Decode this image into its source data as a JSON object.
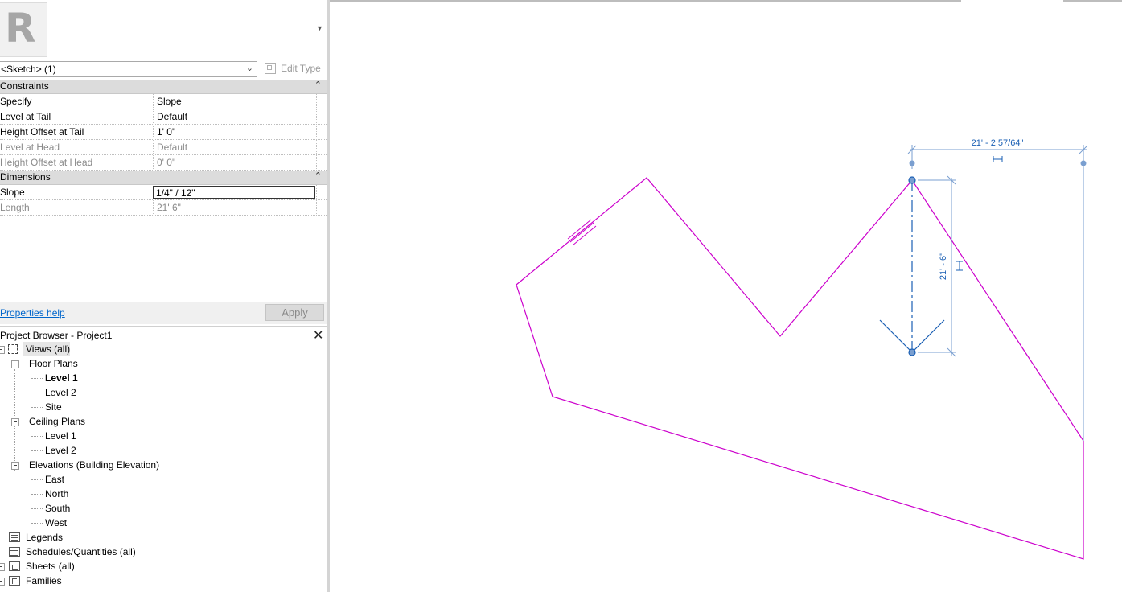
{
  "type_selector": {
    "logo_letter": "R",
    "instance_label": "<Sketch> (1)",
    "edit_type_label": "Edit Type"
  },
  "properties": {
    "groups": [
      {
        "label": "Constraints",
        "rows": [
          {
            "name": "Specify",
            "value": "Slope",
            "dim": false
          },
          {
            "name": "Level at Tail",
            "value": "Default",
            "dim": false
          },
          {
            "name": "Height Offset at Tail",
            "value": "1'  0\"",
            "dim": false
          },
          {
            "name": "Level at Head",
            "value": "Default",
            "dim": true
          },
          {
            "name": "Height Offset at Head",
            "value": "0'  0\"",
            "dim": true
          }
        ]
      },
      {
        "label": "Dimensions",
        "rows": [
          {
            "name": "Slope",
            "value": "1/4\" / 12\"",
            "dim": false,
            "editing": true
          },
          {
            "name": "Length",
            "value": "21'  6\"",
            "dim": true
          }
        ]
      }
    ],
    "help_link": "Properties help",
    "apply_label": "Apply"
  },
  "project_browser": {
    "title": "Project Browser - Project1",
    "tree": {
      "views_all": "Views (all)",
      "floor_plans": "Floor Plans",
      "floor_plan_items": [
        "Level 1",
        "Level 2",
        "Site"
      ],
      "ceiling_plans": "Ceiling Plans",
      "ceiling_plan_items": [
        "Level 1",
        "Level 2"
      ],
      "elevations": "Elevations (Building Elevation)",
      "elevation_items": [
        "East",
        "North",
        "South",
        "West"
      ],
      "legends": "Legends",
      "schedules": "Schedules/Quantities (all)",
      "sheets": "Sheets (all)",
      "families": "Families"
    }
  },
  "canvas": {
    "sketch_line_color": "#cc00cc",
    "dimension_color": "#1a5fb4",
    "horizontal_dimension": "21' - 2 57/64\"",
    "vertical_dimension": "21' - 6\""
  }
}
